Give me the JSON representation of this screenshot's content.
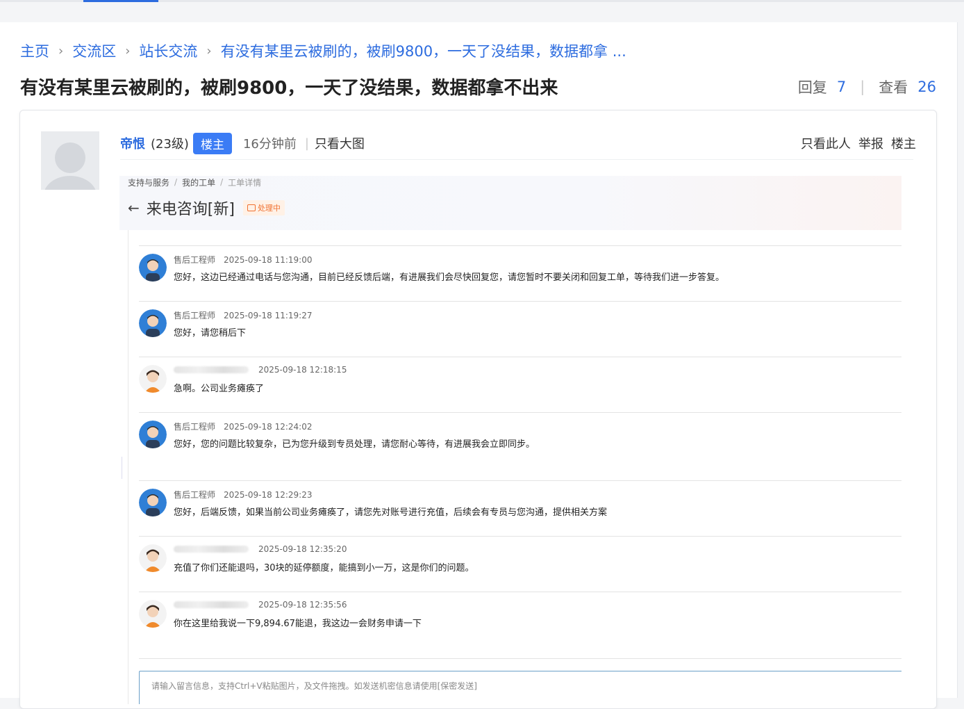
{
  "breadcrumb": {
    "home": "主页",
    "forum": "交流区",
    "board": "站长交流",
    "current": "有没有某里云被刷的，被刷9800，一天了没结果，数据都拿 ..."
  },
  "thread": {
    "title": "有没有某里云被刷的，被刷9800，一天了没结果，数据都拿不出来",
    "reply_label": "回复",
    "reply_count": "7",
    "view_label": "查看",
    "view_count": "26"
  },
  "post": {
    "author": "帝恨",
    "level": "(23级)",
    "host_badge": "楼主",
    "time": "16分钟前",
    "only_big_images": "只看大图",
    "actions": {
      "only_this_user": "只看此人",
      "report": "举报",
      "host": "楼主"
    }
  },
  "screenshot": {
    "breadcrumb": [
      "支持与服务",
      "我的工单",
      "工单详情"
    ],
    "title": "来电咨询[新]",
    "status": "处理中",
    "messages": [
      {
        "role": "engineer",
        "name": "售后工程师",
        "time": "2025-09-18 11:19:00",
        "text": "您好，这边已经通过电话与您沟通，目前已经反馈后端，有进展我们会尽快回复您，请您暂时不要关闭和回复工单，等待我们进一步答复。"
      },
      {
        "role": "engineer",
        "name": "售后工程师",
        "time": "2025-09-18 11:19:27",
        "text": "您好，请您稍后下"
      },
      {
        "role": "user",
        "name": "",
        "time": "2025-09-18 12:18:15",
        "text": "急啊。公司业务瘫痪了"
      },
      {
        "role": "engineer",
        "name": "售后工程师",
        "time": "2025-09-18 12:24:02",
        "text": "您好，您的问题比较复杂，已为您升级到专员处理，请您耐心等待，有进展我会立即同步。"
      },
      {
        "role": "engineer",
        "name": "售后工程师",
        "time": "2025-09-18 12:29:23",
        "text": "您好，后端反馈，如果当前公司业务瘫痪了，请您先对账号进行充值，后续会有专员与您沟通，提供相关方案"
      },
      {
        "role": "user",
        "name": "",
        "time": "2025-09-18 12:35:20",
        "text": "充值了你们还能退吗，30块的延停额度，能搞到小一万，这是你们的问题。"
      },
      {
        "role": "user",
        "name": "",
        "time": "2025-09-18 12:35:56",
        "text": "你在这里给我说一下9,894.67能退，我这边一会财务申请一下"
      }
    ],
    "input_placeholder": "请输入留言信息，支持Ctrl+V粘贴图片，及文件拖拽。如发送机密信息请使用[保密发送]"
  },
  "colors": {
    "accent": "#2d6cdf",
    "badge": "#3b7cf5",
    "status_orange": "#f07030"
  }
}
